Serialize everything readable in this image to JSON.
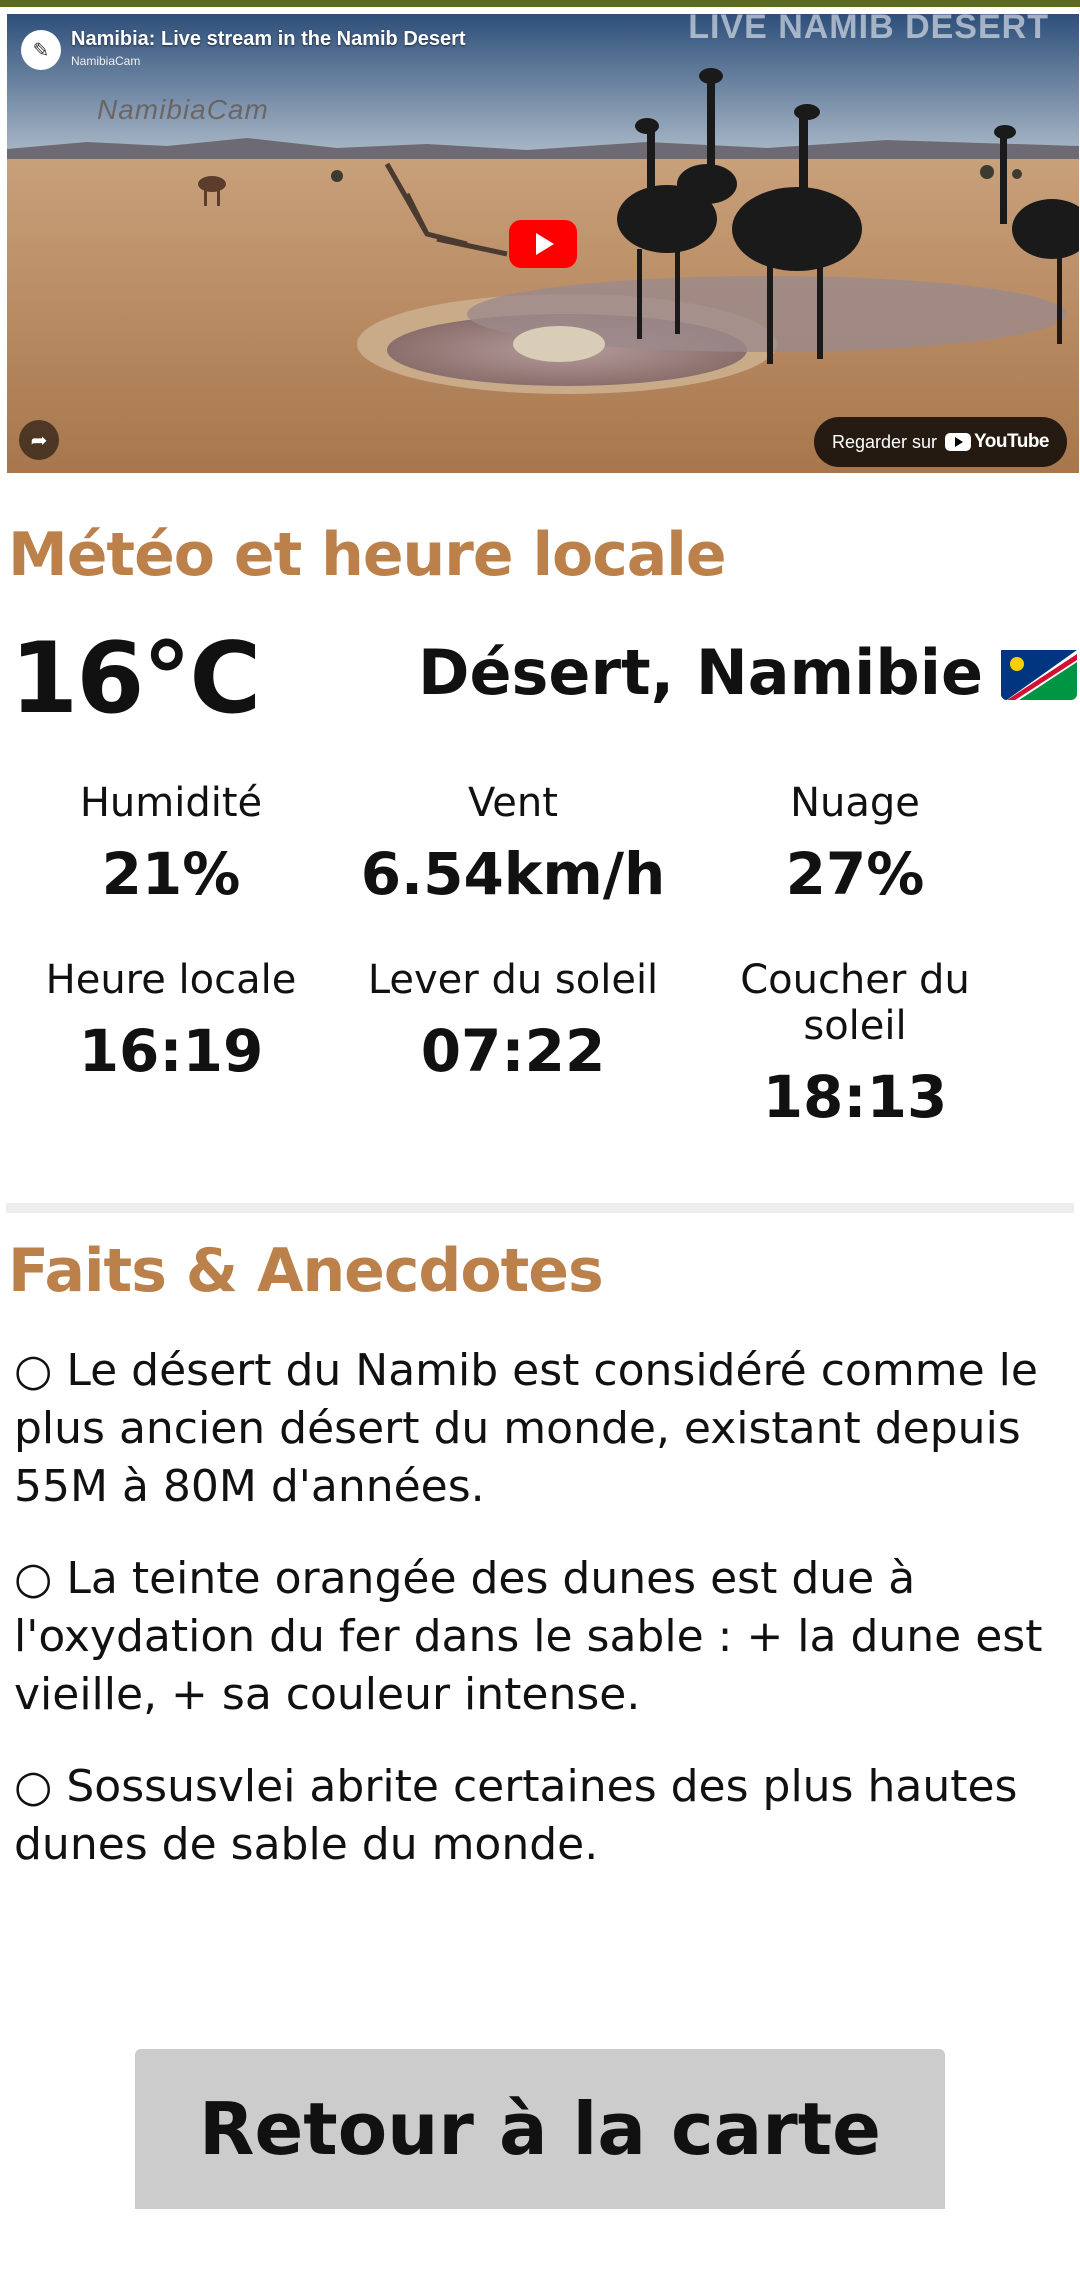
{
  "video": {
    "title": "Namibia: Live stream in the Namib Desert",
    "channel": "NamibiaCam",
    "logo_text": "NamibiaCam",
    "overlay_text": "LIVE   NAMIB DESERT",
    "watch_on_label": "Regarder sur",
    "platform": "YouTube",
    "icons": [
      "channel-avatar-icon",
      "play-icon",
      "share-icon",
      "youtube-logo-icon"
    ]
  },
  "weather": {
    "section_title": "Météo et heure locale",
    "temperature": "16°C",
    "location": "Désert, Namibie",
    "flag_icon": "namibia-flag-icon",
    "stats": [
      {
        "label": "Humidité",
        "value": "21%"
      },
      {
        "label": "Vent",
        "value": "6.54km/h"
      },
      {
        "label": "Nuage",
        "value": "27%"
      },
      {
        "label": "Heure locale",
        "value": "16:19"
      },
      {
        "label": "Lever du soleil",
        "value": "07:22"
      },
      {
        "label": "Coucher du soleil",
        "value": "18:13"
      }
    ]
  },
  "facts": {
    "section_title": "Faits & Anecdotes",
    "items": [
      "○ Le désert du Namib est considéré comme le plus ancien désert du monde, existant depuis 55M à 80M d'années.",
      "○ La teinte orangée des dunes est due à l'oxydation du fer dans le sable : + la dune est vieille, + sa couleur intense.",
      "○ Sossusvlei abrite certaines des plus hautes dunes de sable du monde."
    ]
  },
  "back_button_label": "Retour à la carte",
  "colors": {
    "accent": "#bc804a",
    "top_bar": "#5c6b1e",
    "button_bg": "#cccccc",
    "divider": "#eeeeee"
  }
}
